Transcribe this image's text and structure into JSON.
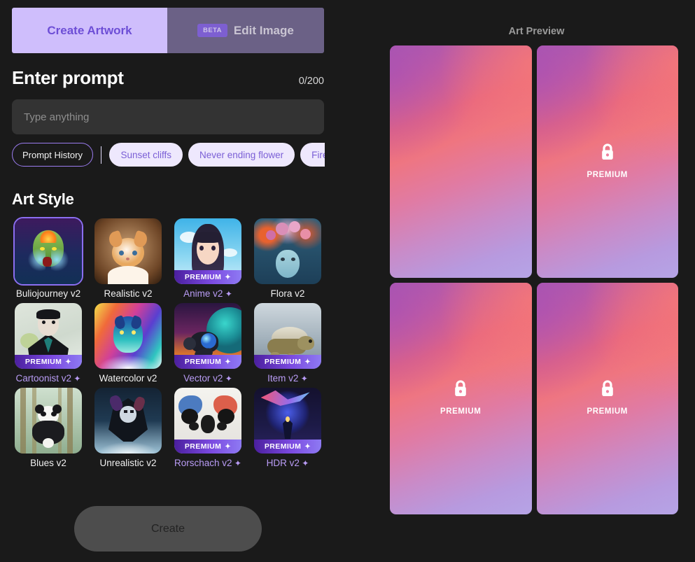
{
  "tabs": [
    {
      "label": "Create Artwork",
      "active": true,
      "badge": null
    },
    {
      "label": "Edit Image",
      "active": false,
      "badge": "BETA"
    }
  ],
  "prompt": {
    "title": "Enter prompt",
    "counter": "0/200",
    "value": "",
    "placeholder": "Type anything"
  },
  "chips": {
    "history_label": "Prompt History",
    "suggestions": [
      "Sunset cliffs",
      "Never ending flower",
      "Fire and water"
    ]
  },
  "art_style": {
    "title": "Art Style",
    "premium_banner_label": "PREMIUM",
    "sparkle_glyph": "✦",
    "items": [
      {
        "label": "Buliojourney v2",
        "premium": false,
        "selected": true,
        "art": "goblin-fairy"
      },
      {
        "label": "Realistic v2",
        "premium": false,
        "selected": false,
        "art": "kitten"
      },
      {
        "label": "Anime v2",
        "premium": true,
        "selected": false,
        "art": "anime-girl"
      },
      {
        "label": "Flora v2",
        "premium": false,
        "selected": false,
        "art": "flora-woman"
      },
      {
        "label": "Cartoonist v2",
        "premium": true,
        "selected": false,
        "art": "cartoon-man"
      },
      {
        "label": "Watercolor v2",
        "premium": false,
        "selected": false,
        "art": "watercolor-wolf"
      },
      {
        "label": "Vector v2",
        "premium": true,
        "selected": false,
        "art": "vector-robot"
      },
      {
        "label": "Item v2",
        "premium": true,
        "selected": false,
        "art": "turtle"
      },
      {
        "label": "Blues v2",
        "premium": false,
        "selected": false,
        "art": "panda"
      },
      {
        "label": "Unrealistic v2",
        "premium": false,
        "selected": false,
        "art": "dark-knight"
      },
      {
        "label": "Rorschach v2",
        "premium": true,
        "selected": false,
        "art": "inkblot"
      },
      {
        "label": "HDR v2",
        "premium": true,
        "selected": false,
        "art": "hdr-lightning"
      }
    ]
  },
  "create_button": {
    "label": "Create",
    "disabled": true
  },
  "preview": {
    "title": "Art Preview",
    "tiles": [
      {
        "locked": false,
        "lock_label": ""
      },
      {
        "locked": true,
        "lock_label": "PREMIUM"
      },
      {
        "locked": true,
        "lock_label": "PREMIUM"
      },
      {
        "locked": true,
        "lock_label": "PREMIUM"
      }
    ]
  },
  "colors": {
    "background": "#1a1a1a",
    "tab_active_bg": "#cfbefc",
    "tab_active_text": "#6d4ed6",
    "tab_inactive_bg": "#6b6186",
    "accent_purple": "#8b6ef0",
    "premium_text": "#b99cf5",
    "chip_bg": "#eee8fd",
    "input_bg": "#333333",
    "create_disabled_bg": "#4d4d4d"
  }
}
